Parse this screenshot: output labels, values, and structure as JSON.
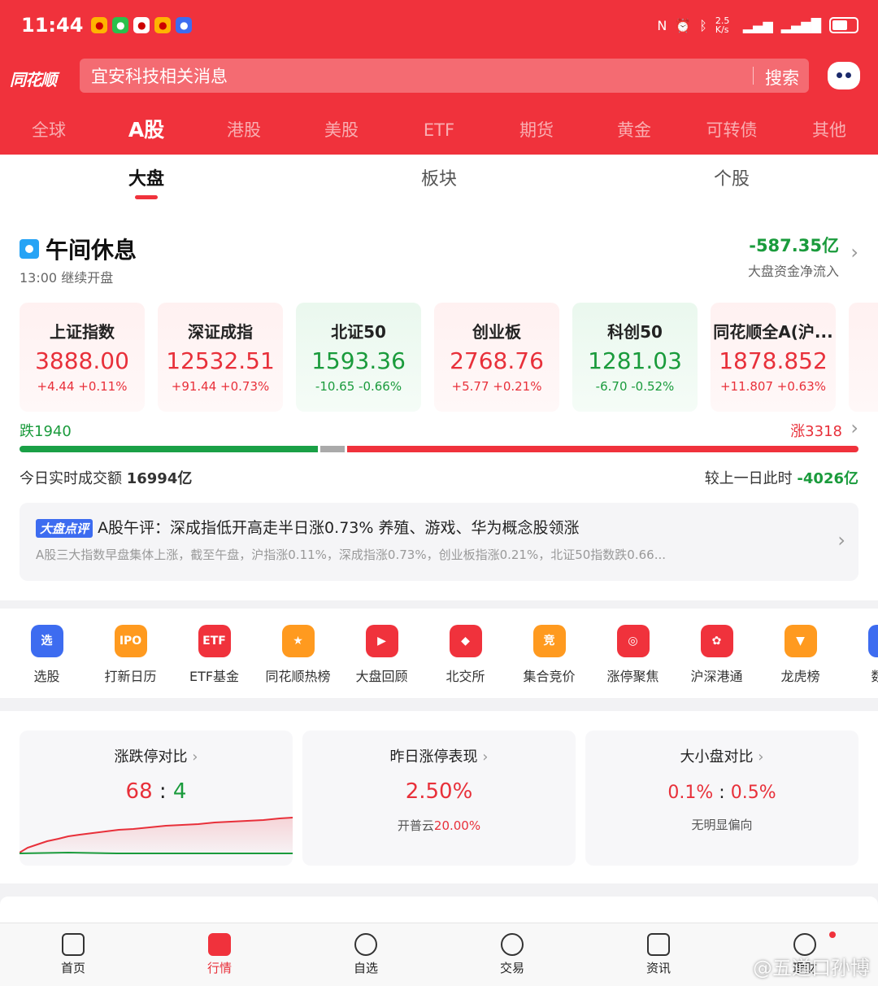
{
  "status": {
    "time": "11:44",
    "net_speed": "2.5 K/s"
  },
  "header": {
    "logo": "同花顺",
    "search_placeholder": "宜安科技相关消息",
    "search_button": "搜索"
  },
  "market_tabs": [
    "全球",
    "A股",
    "港股",
    "美股",
    "ETF",
    "期货",
    "黄金",
    "可转债",
    "其他"
  ],
  "sub_tabs": [
    "大盘",
    "板块",
    "个股"
  ],
  "session": {
    "title": "午间休息",
    "subtitle": "13:00 继续开盘",
    "flow_value": "-587.35亿",
    "flow_label": "大盘资金净流入"
  },
  "indices": [
    {
      "name": "上证指数",
      "price": "3888.00",
      "change": "+4.44  +0.11%",
      "dir": "up"
    },
    {
      "name": "深证成指",
      "price": "12532.51",
      "change": "+91.44  +0.73%",
      "dir": "up"
    },
    {
      "name": "北证50",
      "price": "1593.36",
      "change": "-10.65  -0.66%",
      "dir": "dn"
    },
    {
      "name": "创业板",
      "price": "2768.76",
      "change": "+5.77  +0.21%",
      "dir": "up"
    },
    {
      "name": "科创50",
      "price": "1281.03",
      "change": "-6.70  -0.52%",
      "dir": "dn"
    },
    {
      "name": "同花顺全A(沪...",
      "price": "1878.852",
      "change": "+11.807  +0.63%",
      "dir": "up"
    }
  ],
  "breadth": {
    "down": "跌1940",
    "up": "涨3318",
    "down_count": 1940,
    "up_count": 3318
  },
  "turnover": {
    "label": "今日实时成交额",
    "value": "16994亿",
    "compare_label": "较上一日此时",
    "compare_value": "-4026亿"
  },
  "review": {
    "badge": "大盘点评",
    "headline": "A股午评：深成指低开高走半日涨0.73% 养殖、游戏、华为概念股领涨",
    "body": "A股三大指数早盘集体上涨，截至午盘，沪指涨0.11%，深成指涨0.73%，创业板指涨0.21%，北证50指数跌0.66..."
  },
  "shortcuts": [
    {
      "label": "选股",
      "glyph": "选",
      "color": "#3d6cf0"
    },
    {
      "label": "打新日历",
      "glyph": "IPO",
      "color": "#ff9a1f"
    },
    {
      "label": "ETF基金",
      "glyph": "ETF",
      "color": "#f0323c"
    },
    {
      "label": "同花顺热榜",
      "glyph": "★",
      "color": "#ff9a1f"
    },
    {
      "label": "大盘回顾",
      "glyph": "▶",
      "color": "#f0323c"
    },
    {
      "label": "北交所",
      "glyph": "◆",
      "color": "#f0323c"
    },
    {
      "label": "集合竞价",
      "glyph": "竞",
      "color": "#ff9a1f"
    },
    {
      "label": "涨停聚焦",
      "glyph": "◎",
      "color": "#f0323c"
    },
    {
      "label": "沪深港通",
      "glyph": "✿",
      "color": "#f0323c"
    },
    {
      "label": "龙虎榜",
      "glyph": "▼",
      "color": "#ff9a1f"
    },
    {
      "label": "数据",
      "glyph": "●",
      "color": "#3d6cf0"
    }
  ],
  "stats": {
    "limit": {
      "title": "涨跌停对比",
      "up": "68",
      "sep": ":",
      "down": "4"
    },
    "yesterday": {
      "title": "昨日涨停表现",
      "value": "2.50%",
      "sub_label": "开普云",
      "sub_value": "20.00%"
    },
    "size": {
      "title": "大小盘对比",
      "small": "0.1%",
      "sep": ":",
      "large": "0.5%",
      "note": "无明显偏向"
    }
  },
  "bottom_nav": [
    "首页",
    "行情",
    "自选",
    "交易",
    "资讯",
    "理财"
  ],
  "watermark": "@五道口孙博"
}
